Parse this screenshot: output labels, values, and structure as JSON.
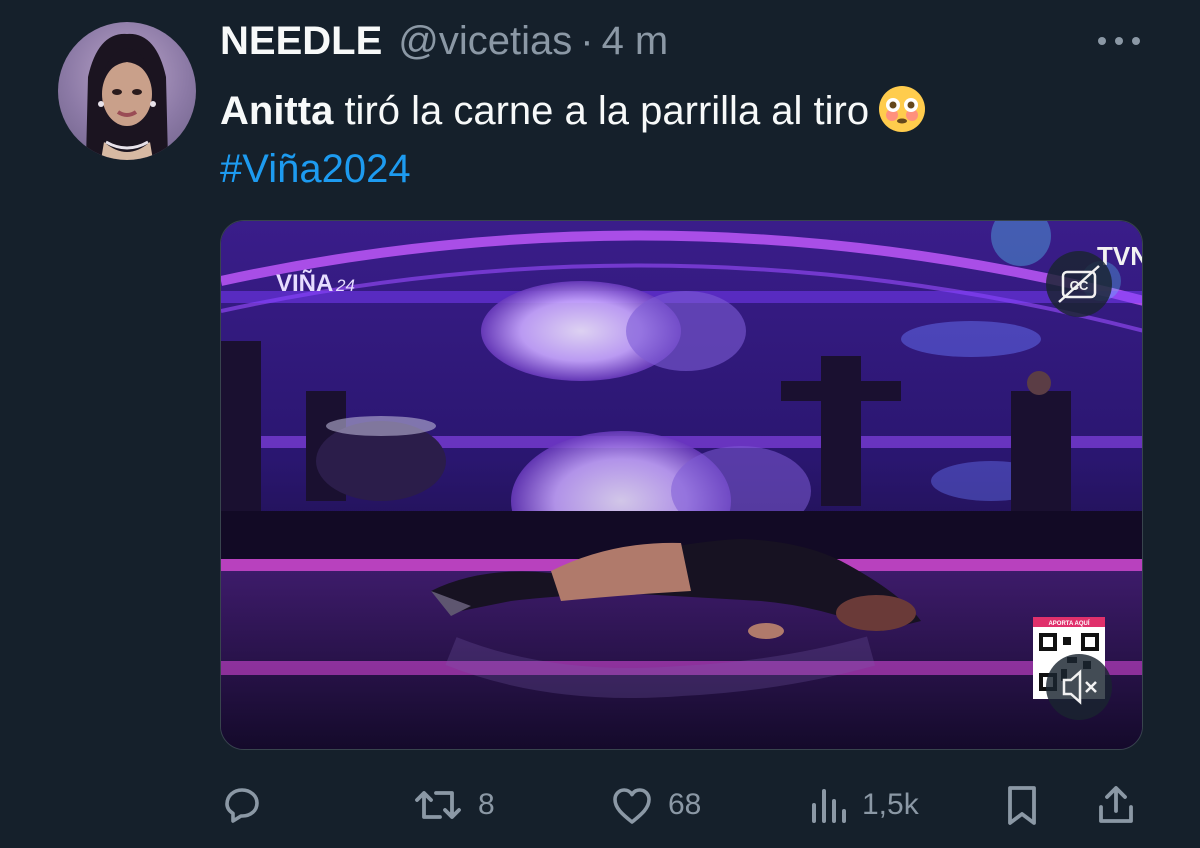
{
  "tweet": {
    "display_name": "NEEDLE",
    "handle": "@vicetias",
    "separator": "·",
    "timestamp": "4 m",
    "text_bold": "Anitta",
    "text_rest": " tiró la carne a la parrilla al tiro",
    "emoji": "flushed-face-emoji",
    "hashtag": "#Viña2024"
  },
  "media": {
    "logo_text": "VIÑA",
    "logo_year": "24",
    "channel": "TVN",
    "cc_label": "CC",
    "qr_label": "APORTA AQUÍ"
  },
  "actions": {
    "reply": {
      "icon": "reply-icon",
      "count": ""
    },
    "retweet": {
      "icon": "retweet-icon",
      "count": "8"
    },
    "like": {
      "icon": "heart-icon",
      "count": "68"
    },
    "views": {
      "icon": "views-icon",
      "count": "1,5k"
    },
    "bookmark": {
      "icon": "bookmark-icon"
    },
    "share": {
      "icon": "share-icon"
    }
  },
  "colors": {
    "background": "#15202b",
    "text": "#f7f9f9",
    "secondary": "#8b98a5",
    "link": "#1d9bf0"
  }
}
